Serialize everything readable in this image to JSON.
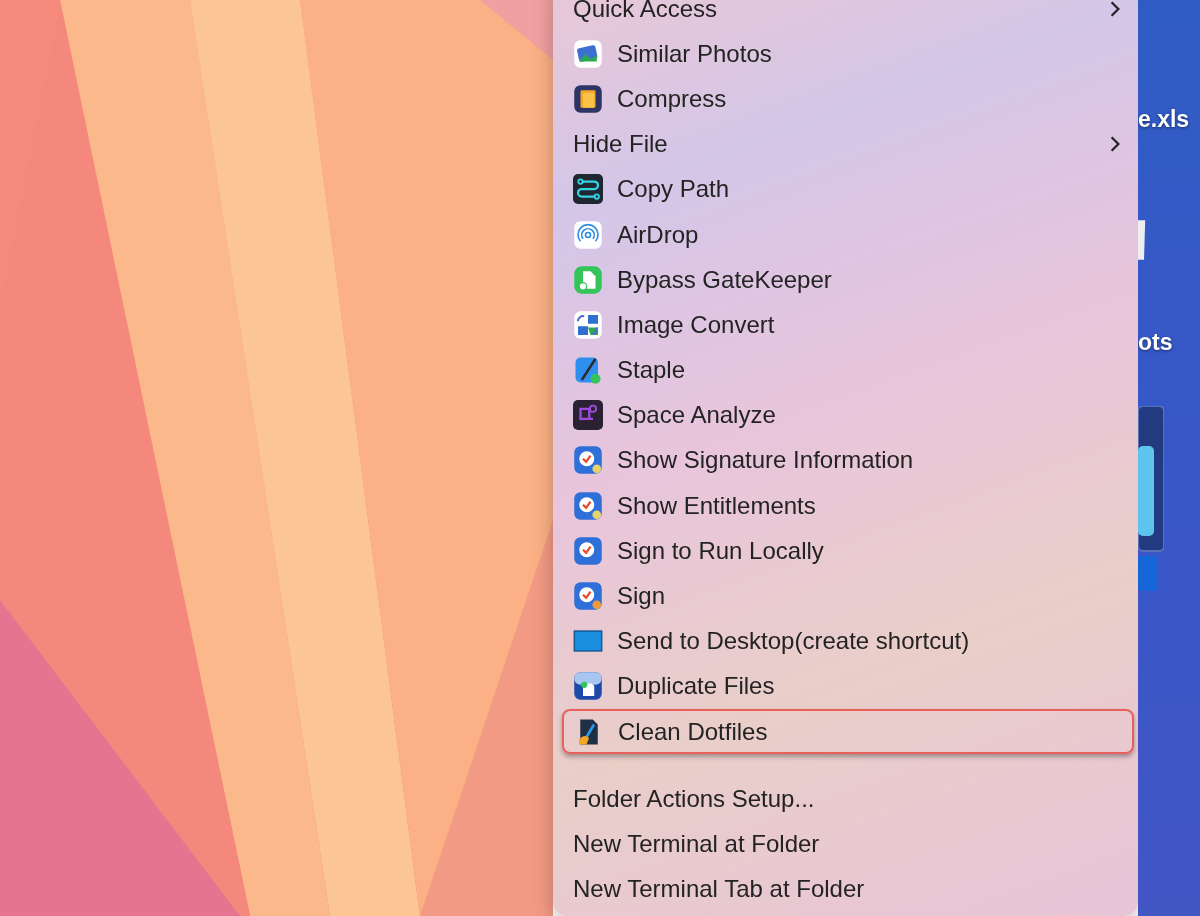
{
  "menu": {
    "items": [
      {
        "kind": "submenu",
        "label": "Quick Access",
        "outlined": false
      },
      {
        "kind": "app",
        "label": "Similar Photos",
        "outlined": false
      },
      {
        "kind": "app",
        "label": "Compress",
        "outlined": false
      },
      {
        "kind": "submenu",
        "label": "Hide File",
        "outlined": false
      },
      {
        "kind": "app",
        "label": "Copy Path",
        "outlined": false
      },
      {
        "kind": "app",
        "label": "AirDrop",
        "outlined": false
      },
      {
        "kind": "app",
        "label": "Bypass GateKeeper",
        "outlined": false
      },
      {
        "kind": "app",
        "label": "Image Convert",
        "outlined": false
      },
      {
        "kind": "app",
        "label": "Staple",
        "outlined": false
      },
      {
        "kind": "app",
        "label": "Space Analyze",
        "outlined": false
      },
      {
        "kind": "app",
        "label": "Show Signature Information",
        "outlined": false
      },
      {
        "kind": "app",
        "label": "Show Entitlements",
        "outlined": false
      },
      {
        "kind": "app",
        "label": "Sign to Run Locally",
        "outlined": false
      },
      {
        "kind": "app",
        "label": "Sign",
        "outlined": false
      },
      {
        "kind": "app",
        "label": "Send to Desktop(create shortcut)",
        "outlined": false
      },
      {
        "kind": "app",
        "label": "Duplicate Files",
        "outlined": false
      },
      {
        "kind": "app",
        "label": "Clean Dotfiles",
        "outlined": true
      },
      {
        "kind": "separator"
      },
      {
        "kind": "plain",
        "label": "Folder Actions Setup...",
        "outlined": false
      },
      {
        "kind": "plain",
        "label": "New Terminal at Folder",
        "outlined": false
      },
      {
        "kind": "plain",
        "label": "New Terminal Tab at Folder",
        "outlined": false
      }
    ]
  },
  "desktop": {
    "labels": [
      "e.xls",
      "ots"
    ]
  }
}
